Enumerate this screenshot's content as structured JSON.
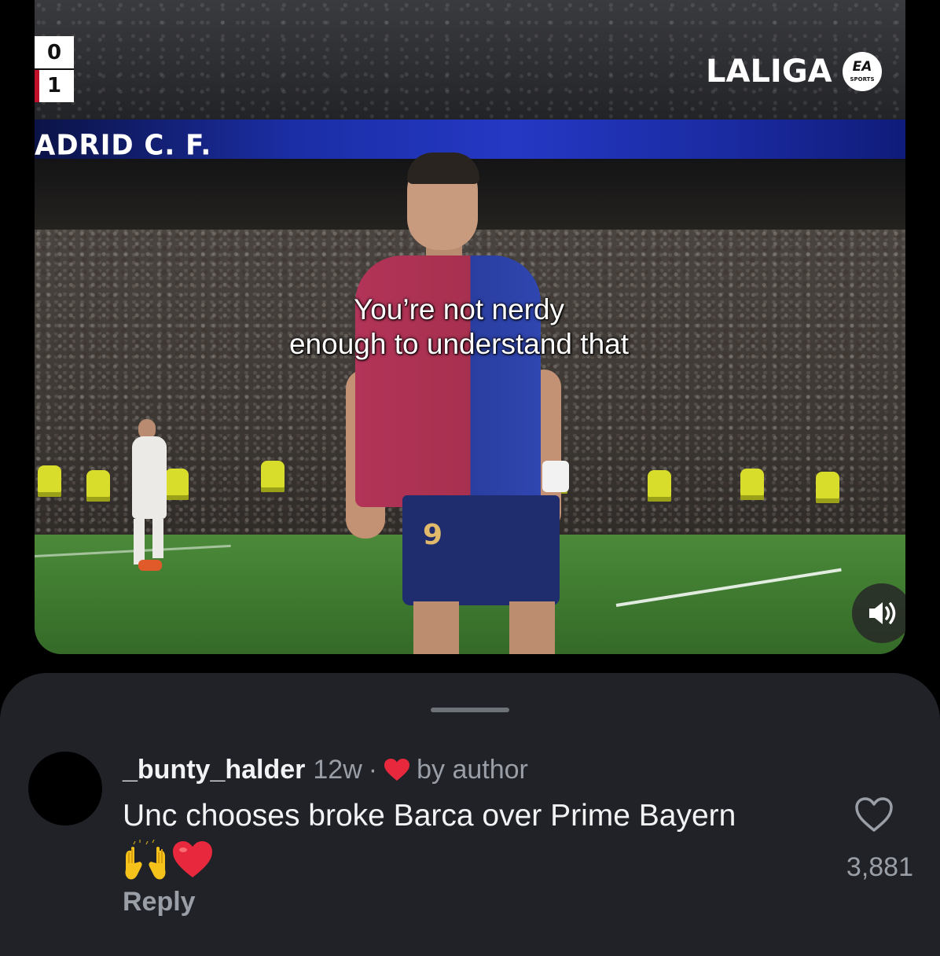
{
  "video": {
    "scoreboard": {
      "home_score": "0",
      "away_score": "1"
    },
    "broadcaster_logo": "LALIGA",
    "sponsor_badge": {
      "top": "EA",
      "bottom": "SPORTS"
    },
    "stadium_banner": "ADRID C. F.",
    "player_number": "9",
    "caption_lines": [
      "You’re not nerdy",
      "enough to understand that"
    ],
    "sound_icon": "speaker-on-icon"
  },
  "comment": {
    "username": "_bunty_halder",
    "time_ago": "12w",
    "separator": "·",
    "liked_by": "by author",
    "text": "Unc chooses broke Barca over Prime Bayern",
    "emojis": [
      "raising-hands-emoji",
      "red-heart-emoji"
    ],
    "reply_label": "Reply",
    "like_count": "3,881"
  },
  "colors": {
    "sheet_background": "#202227",
    "secondary_text": "#9a9ea6",
    "heart_red": "#e8283c",
    "barca_red": "#b23458",
    "barca_blue": "#3046b0"
  }
}
